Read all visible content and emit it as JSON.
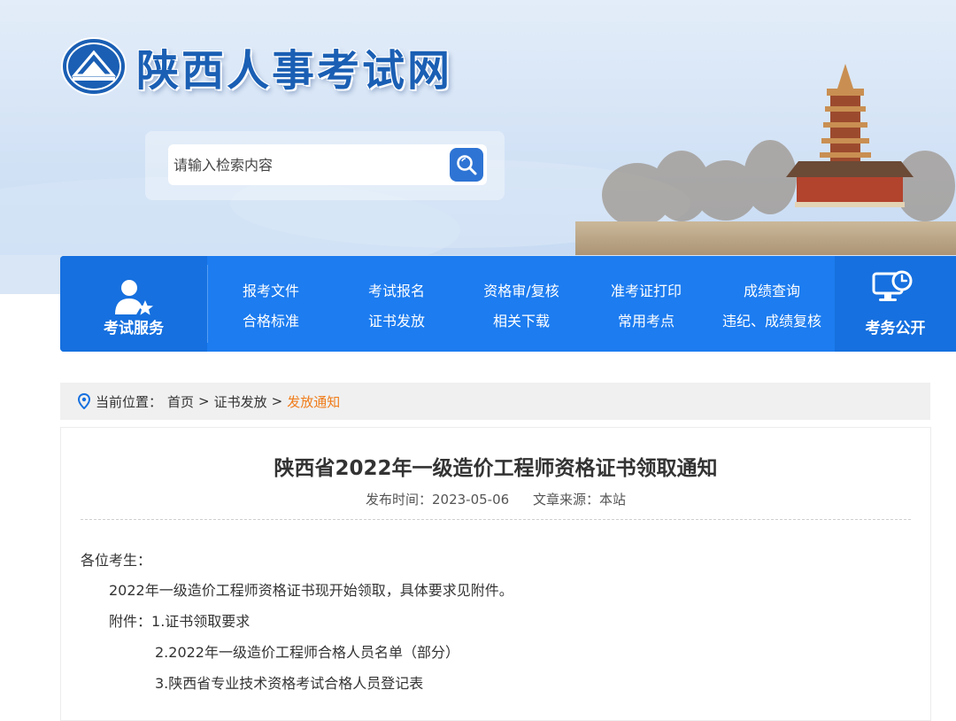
{
  "header": {
    "site_name": "陕西人事考试网",
    "search_placeholder": "请输入检索内容"
  },
  "nav": {
    "left_label": "考试服务",
    "right_label": "考务公开",
    "items": [
      {
        "label": "报考文件"
      },
      {
        "label": "考试报名"
      },
      {
        "label": "资格审/复核"
      },
      {
        "label": "准考证打印"
      },
      {
        "label": "成绩查询"
      },
      {
        "label": "合格标准"
      },
      {
        "label": "证书发放"
      },
      {
        "label": "相关下载"
      },
      {
        "label": "常用考点"
      },
      {
        "label": "违纪、成绩复核"
      }
    ]
  },
  "breadcrumb": {
    "prefix": "当前位置：",
    "items": [
      "首页",
      "证书发放",
      "发放通知"
    ],
    "separator": ">"
  },
  "article": {
    "title": "陕西省2022年一级造价工程师资格证书领取通知",
    "publish_label": "发布时间：2023-05-06",
    "source_label": "文章来源：本站",
    "greeting": "各位考生：",
    "body": "2022年一级造价工程师资格证书现开始领取，具体要求见附件。",
    "attachments_label": "附件：",
    "attachments": [
      "1.证书领取要求",
      "2.2022年一级造价工程师合格人员名单（部分）",
      "3.陕西省专业技术资格考试合格人员登记表"
    ]
  },
  "colors": {
    "nav_blue": "#1c7cf0",
    "nav_dark": "#1670df",
    "brand_blue": "#1a5fb4",
    "breadcrumb_current": "#f07c1a"
  },
  "icons": {
    "logo": "emblem-icon",
    "search": "search-icon",
    "exam_service": "user-star-icon",
    "public_affairs": "monitor-clock-icon",
    "location": "location-pin-icon"
  }
}
